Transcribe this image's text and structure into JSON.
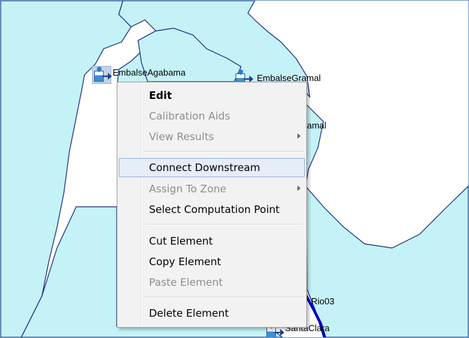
{
  "map": {
    "elements": {
      "embalse_agabama": "EmbalseAgabama",
      "embalse_gramal": "EmbalseGramal",
      "gramal_partial": "amal",
      "rio03": "Rio03",
      "santa_clara": "SantaClara"
    },
    "colors": {
      "subbasin_fill": "#c4f2f7",
      "subbasin_border": "#1a2d7a",
      "reach": "#0000cc"
    }
  },
  "context_menu": {
    "items": {
      "edit": "Edit",
      "calibration_aids": "Calibration Aids",
      "view_results": "View Results",
      "connect_downstream": "Connect Downstream",
      "assign_to_zone": "Assign To Zone",
      "select_computation_point": "Select Computation Point",
      "cut_element": "Cut Element",
      "copy_element": "Copy Element",
      "paste_element": "Paste Element",
      "delete_element": "Delete Element"
    },
    "disabled_items": [
      "Calibration Aids",
      "View Results",
      "Assign To Zone",
      "Paste Element"
    ],
    "highlighted_item": "Connect Downstream"
  }
}
